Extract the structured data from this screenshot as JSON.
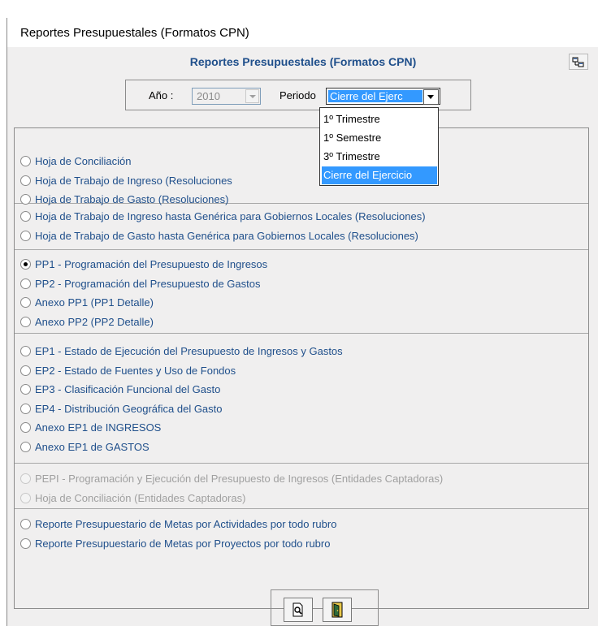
{
  "window": {
    "title": "Reportes Presupuestales (Formatos CPN)"
  },
  "header": {
    "title": "Reportes Presupuestales (Formatos CPN)",
    "tool_icon": "report-settings-icon"
  },
  "filters": {
    "year_label": "Año :",
    "year_value": "2010",
    "period_label": "Periodo",
    "period_value": "Cierre del Ejerc"
  },
  "period_options": [
    "1º Trimestre",
    "1º Semestre",
    "3º Trimestre",
    "Cierre del Ejercicio"
  ],
  "period_selected_index": 3,
  "report_groups": [
    {
      "items": [
        {
          "label": "Hoja de Conciliación",
          "checked": false,
          "enabled": true
        },
        {
          "label": "Hoja de Trabajo de Ingreso (Resoluciones",
          "checked": false,
          "enabled": true
        },
        {
          "label": "Hoja de Trabajo de Gasto (Resoluciones)",
          "checked": false,
          "enabled": true
        }
      ]
    },
    {
      "items": [
        {
          "label": "Hoja de Trabajo de Ingreso hasta Genérica para Gobiernos Locales (Resoluciones)",
          "checked": false,
          "enabled": true
        },
        {
          "label": "Hoja de Trabajo de Gasto hasta Genérica para Gobiernos Locales (Resoluciones)",
          "checked": false,
          "enabled": true
        }
      ]
    },
    {
      "items": [
        {
          "label": "PP1 - Programación del Presupuesto de Ingresos",
          "checked": true,
          "enabled": true
        },
        {
          "label": "PP2 - Programación del Presupuesto de Gastos",
          "checked": false,
          "enabled": true
        },
        {
          "label": "Anexo PP1 (PP1 Detalle)",
          "checked": false,
          "enabled": true
        },
        {
          "label": "Anexo PP2 (PP2 Detalle)",
          "checked": false,
          "enabled": true
        }
      ]
    },
    {
      "items": [
        {
          "label": "EP1 - Estado de Ejecución del Presupuesto de Ingresos y Gastos",
          "checked": false,
          "enabled": true
        },
        {
          "label": "EP2 - Estado de Fuentes y Uso de Fondos",
          "checked": false,
          "enabled": true
        },
        {
          "label": "EP3 - Clasificación Funcional del Gasto",
          "checked": false,
          "enabled": true
        },
        {
          "label": "EP4 - Distribución Geográfica del Gasto",
          "checked": false,
          "enabled": true
        },
        {
          "label": "Anexo EP1 de INGRESOS",
          "checked": false,
          "enabled": true
        },
        {
          "label": "Anexo EP1 de GASTOS",
          "checked": false,
          "enabled": true
        }
      ]
    },
    {
      "items": [
        {
          "label": "PEPI - Programación y Ejecución del Presupuesto de Ingresos (Entidades Captadoras)",
          "checked": false,
          "enabled": false
        },
        {
          "label": "Hoja de Conciliación (Entidades Captadoras)",
          "checked": false,
          "enabled": false
        }
      ]
    },
    {
      "items": [
        {
          "label": "Reporte Presupuestario de Metas por Actividades por todo rubro",
          "checked": false,
          "enabled": true
        },
        {
          "label": "Reporte Presupuestario de Metas por Proyectos por todo rubro",
          "checked": false,
          "enabled": true
        }
      ]
    }
  ],
  "buttons": {
    "preview_icon": "print-preview-icon",
    "exit_icon": "exit-door-icon"
  },
  "colors": {
    "accent": "#1f4f8b",
    "selection": "#3399ff",
    "background": "#f0efef"
  }
}
